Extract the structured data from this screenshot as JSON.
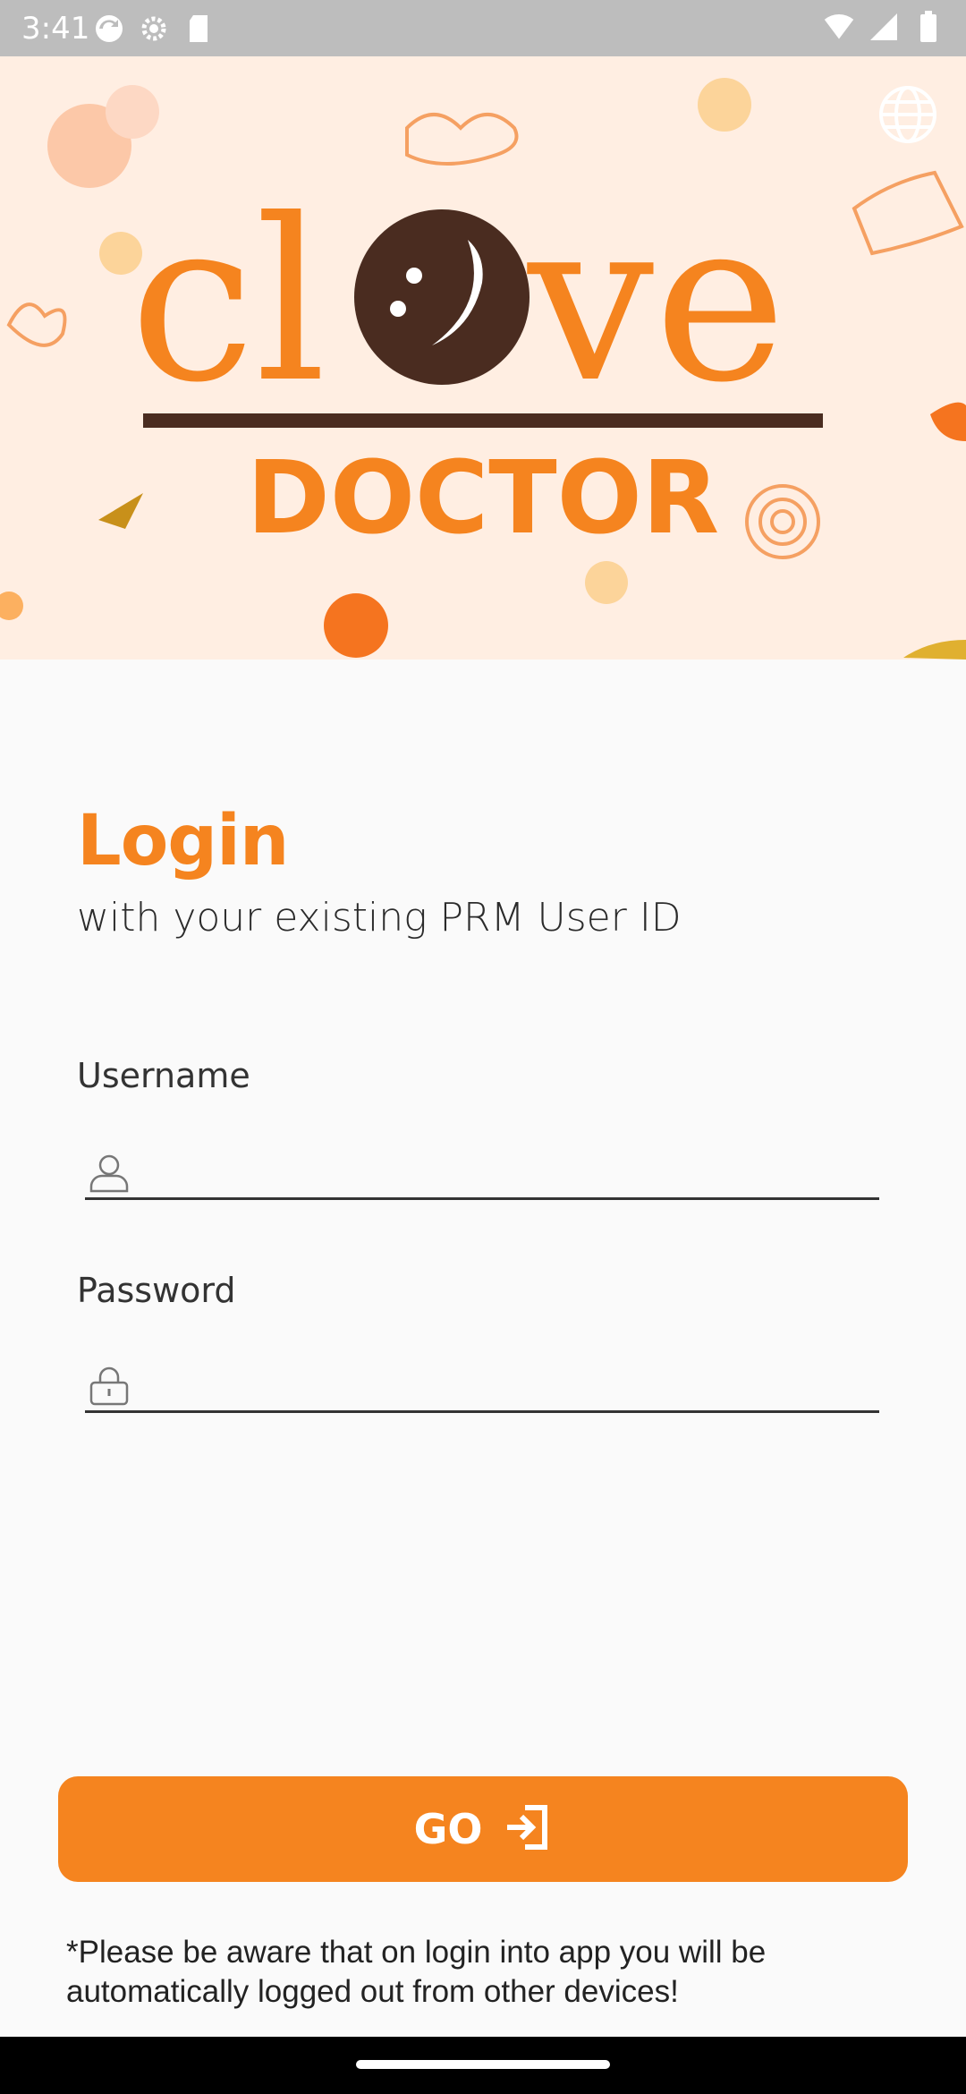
{
  "status_bar": {
    "time": "3:41",
    "left_icons": [
      "sync-icon",
      "settings-icon",
      "sd-card-icon"
    ],
    "right_icons": [
      "wifi-icon",
      "signal-icon",
      "battery-icon"
    ]
  },
  "banner": {
    "logo_text": "clove",
    "logo_subtext": "DOCTOR",
    "brand_orange": "#f5841f",
    "brand_brown": "#4a2c20",
    "language_icon": "globe-icon"
  },
  "login": {
    "title": "Login",
    "subtitle": "with your existing PRM User ID"
  },
  "form": {
    "username_label": "Username",
    "username_value": "",
    "username_placeholder": "",
    "username_icon": "user-icon",
    "password_label": "Password",
    "password_value": "",
    "password_placeholder": "",
    "password_icon": "lock-icon"
  },
  "go_button": {
    "label": "GO",
    "icon": "login-arrow-icon"
  },
  "note": "*Please be aware that on login into app you will be automatically logged out from other devices!",
  "colors": {
    "accent": "#f5841f",
    "background": "#fafafa",
    "banner_bg": "#ffeee2"
  }
}
